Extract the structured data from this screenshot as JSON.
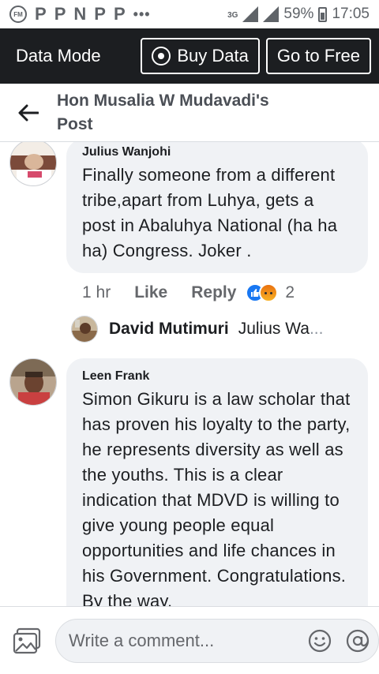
{
  "status_bar": {
    "left_icons": [
      "fm-radio-icon",
      "p-icon",
      "p-icon",
      "n-icon",
      "p-icon",
      "p-icon",
      "more-dots-icon"
    ],
    "fm": "FM",
    "glyphs": [
      "P",
      "P",
      "N",
      "P",
      "P"
    ],
    "dots": "•••",
    "network": "3G",
    "battery": "59%",
    "time": "17:05"
  },
  "data_bar": {
    "mode_label": "Data Mode",
    "buy_data_label": "Buy Data",
    "go_free_label": "Go to Free"
  },
  "post_header": {
    "title": "Hon Musalia W Mudavadi's Post"
  },
  "comments": [
    {
      "author": "Julius Wanjohi",
      "text": "Finally someone from a different tribe,apart from Luhya, gets a post in Abaluhya National (ha ha ha) Congress. Joker .",
      "time": "1 hr",
      "like_label": "Like",
      "reply_label": "Reply",
      "reaction_count": "2",
      "reactions": [
        "like",
        "angry"
      ],
      "reply_preview": {
        "author": "David Mutimuri",
        "snippet": "Julius Wa",
        "ellipsis": "..."
      }
    },
    {
      "author": "Leen Frank",
      "text": "Simon Gikuru is a law scholar that has proven his loyalty to the party, he represents diversity as well as the youths. This is a clear indication that MDVD is willing to give young people equal opportunities and life chances in his Government. Congratulations. By the way,"
    }
  ],
  "composer": {
    "placeholder": "Write a comment..."
  },
  "colors": {
    "dark_bar": "#1c1e21",
    "bubble": "#f0f2f5",
    "link_blue": "#1877f2"
  }
}
